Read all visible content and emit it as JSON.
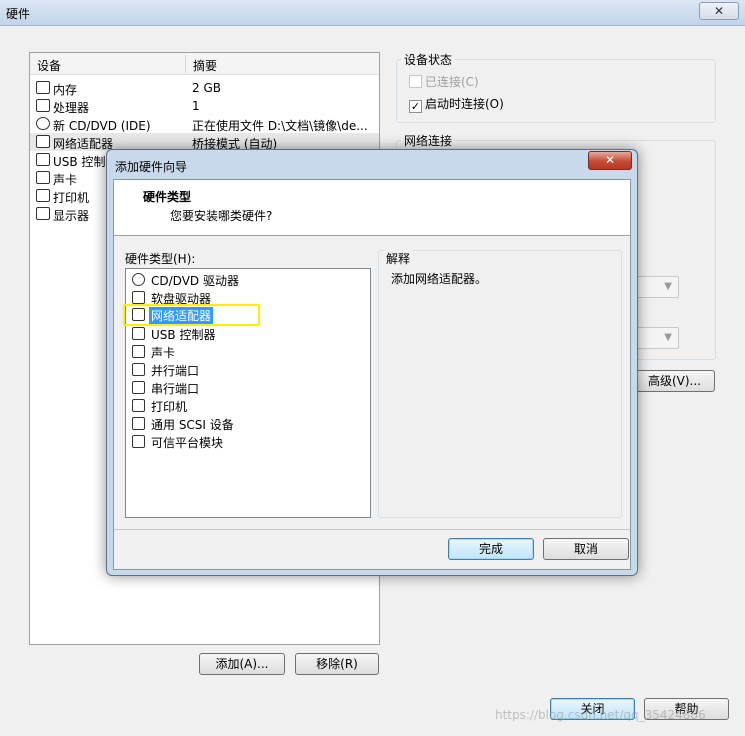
{
  "window": {
    "title": "硬件",
    "close_label": "✕"
  },
  "devices": {
    "col_device": "设备",
    "col_summary": "摘要",
    "items": [
      {
        "name": "内存",
        "summary": "2 GB",
        "icon": "memory-icon"
      },
      {
        "name": "处理器",
        "summary": "1",
        "icon": "cpu-icon"
      },
      {
        "name": "新 CD/DVD (IDE)",
        "summary": "正在使用文件 D:\\文档\\镜像\\de...",
        "icon": "cd-icon"
      },
      {
        "name": "网络适配器",
        "summary": "桥接模式 (自动)",
        "icon": "network-icon"
      },
      {
        "name": "USB 控制器",
        "summary": "",
        "icon": "usb-icon"
      },
      {
        "name": "声卡",
        "summary": "",
        "icon": "sound-icon"
      },
      {
        "name": "打印机",
        "summary": "",
        "icon": "printer-icon"
      },
      {
        "name": "显示器",
        "summary": "",
        "icon": "monitor-icon"
      }
    ],
    "add_label": "添加(A)...",
    "remove_label": "移除(R)"
  },
  "device_status": {
    "title": "设备状态",
    "connected_label": "已连接(C)",
    "connected_checked": false,
    "power_on_label": "启动时连接(O)",
    "power_on_checked": true
  },
  "network": {
    "title": "网络连接",
    "advanced_label": "高级(V)..."
  },
  "footer": {
    "close_label": "关闭",
    "help_label": "帮助"
  },
  "wizard": {
    "title": "添加硬件向导",
    "close_label": "✕",
    "heading": "硬件类型",
    "subheading": "您要安装哪类硬件?",
    "list_label": "硬件类型(H):",
    "items": [
      {
        "label": "CD/DVD 驱动器",
        "icon": "cd-icon"
      },
      {
        "label": "软盘驱动器",
        "icon": "floppy-icon"
      },
      {
        "label": "网络适配器",
        "icon": "network-icon"
      },
      {
        "label": "USB 控制器",
        "icon": "usb-icon"
      },
      {
        "label": "声卡",
        "icon": "sound-icon"
      },
      {
        "label": "并行端口",
        "icon": "parallel-port-icon"
      },
      {
        "label": "串行端口",
        "icon": "serial-port-icon"
      },
      {
        "label": "打印机",
        "icon": "printer-icon"
      },
      {
        "label": "通用 SCSI 设备",
        "icon": "scsi-icon"
      },
      {
        "label": "可信平台模块",
        "icon": "tpm-icon"
      }
    ],
    "selected_index": 2,
    "explain_title": "解释",
    "explain_text": "添加网络适配器。",
    "finish_label": "完成",
    "cancel_label": "取消"
  },
  "watermark": "https://blog.csdn.net/qq_35424886",
  "colors": {
    "selection": "#3399ff",
    "highlight_box": "#fff200",
    "close_red": "#c54b35"
  }
}
